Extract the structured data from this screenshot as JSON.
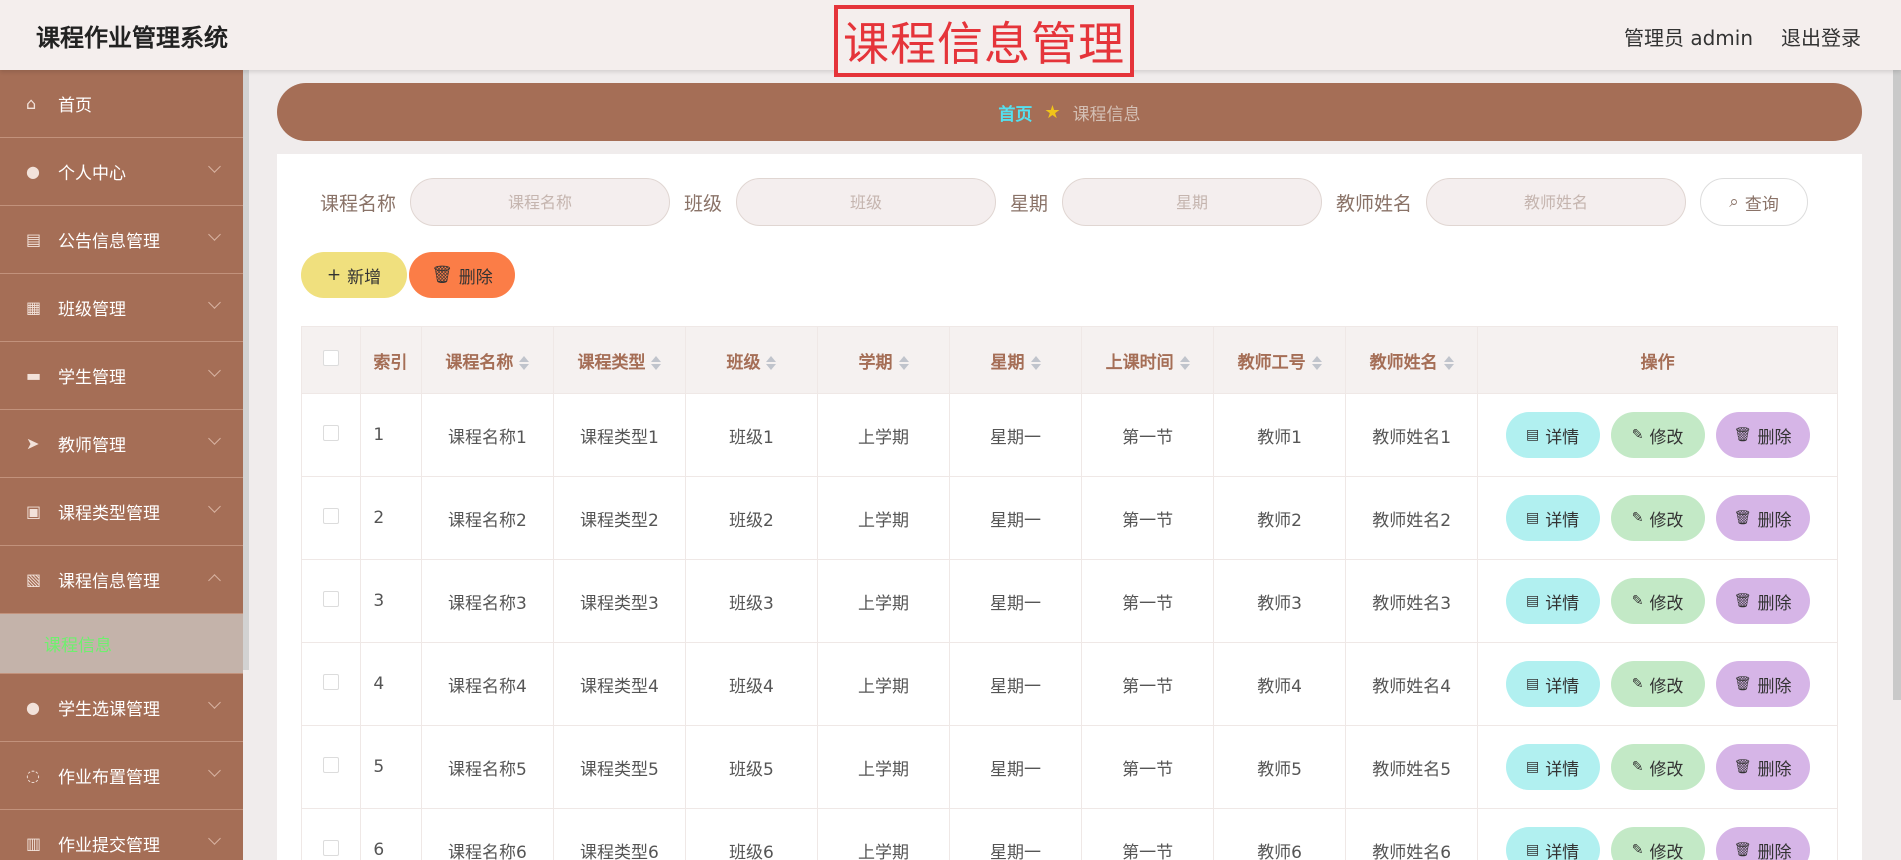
{
  "header": {
    "system_title": "课程作业管理系统",
    "page_title": "课程信息管理",
    "user_label": "管理员 admin",
    "logout_label": "退出登录"
  },
  "sidebar": {
    "items": [
      {
        "label": "首页",
        "icon": "home-icon",
        "glyph": "⌂",
        "has_arrow": false
      },
      {
        "label": "个人中心",
        "icon": "user-icon",
        "glyph": "●",
        "has_arrow": true
      },
      {
        "label": "公告信息管理",
        "icon": "clipboard-icon",
        "glyph": "▤",
        "has_arrow": true
      },
      {
        "label": "班级管理",
        "icon": "grid-icon",
        "glyph": "▦",
        "has_arrow": true
      },
      {
        "label": "学生管理",
        "icon": "briefcase-icon",
        "glyph": "▬",
        "has_arrow": true
      },
      {
        "label": "教师管理",
        "icon": "send-icon",
        "glyph": "➤",
        "has_arrow": true
      },
      {
        "label": "课程类型管理",
        "icon": "toolbox-icon",
        "glyph": "▣",
        "has_arrow": true
      },
      {
        "label": "课程信息管理",
        "icon": "document-icon",
        "glyph": "▧",
        "has_arrow": true,
        "expanded": true
      }
    ],
    "subitem": "课程信息",
    "items_after": [
      {
        "label": "学生选课管理",
        "icon": "user-icon",
        "glyph": "●"
      },
      {
        "label": "作业布置管理",
        "icon": "power-icon",
        "glyph": "◌"
      },
      {
        "label": "作业提交管理",
        "icon": "bookshelf-icon",
        "glyph": "▥"
      }
    ]
  },
  "breadcrumb": {
    "home": "首页",
    "current": "课程信息"
  },
  "search": {
    "course_name_label": "课程名称",
    "course_name_placeholder": "课程名称",
    "class_label": "班级",
    "class_placeholder": "班级",
    "weekday_label": "星期",
    "weekday_placeholder": "星期",
    "teacher_label": "教师姓名",
    "teacher_placeholder": "教师姓名",
    "query_label": "查询"
  },
  "actions": {
    "add_label": "新增",
    "delete_label": "删除"
  },
  "table": {
    "headers": {
      "index": "索引",
      "course_name": "课程名称",
      "course_type": "课程类型",
      "class": "班级",
      "term": "学期",
      "weekday": "星期",
      "time": "上课时间",
      "teacher_id": "教师工号",
      "teacher_name": "教师姓名",
      "ops": "操作"
    },
    "ops_labels": {
      "detail": "详情",
      "edit": "修改",
      "remove": "删除"
    },
    "rows": [
      {
        "index": "1",
        "course_name": "课程名称1",
        "course_type": "课程类型1",
        "class": "班级1",
        "term": "上学期",
        "weekday": "星期一",
        "time": "第一节",
        "teacher_id": "教师1",
        "teacher_name": "教师姓名1"
      },
      {
        "index": "2",
        "course_name": "课程名称2",
        "course_type": "课程类型2",
        "class": "班级2",
        "term": "上学期",
        "weekday": "星期一",
        "time": "第一节",
        "teacher_id": "教师2",
        "teacher_name": "教师姓名2"
      },
      {
        "index": "3",
        "course_name": "课程名称3",
        "course_type": "课程类型3",
        "class": "班级3",
        "term": "上学期",
        "weekday": "星期一",
        "time": "第一节",
        "teacher_id": "教师3",
        "teacher_name": "教师姓名3"
      },
      {
        "index": "4",
        "course_name": "课程名称4",
        "course_type": "课程类型4",
        "class": "班级4",
        "term": "上学期",
        "weekday": "星期一",
        "time": "第一节",
        "teacher_id": "教师4",
        "teacher_name": "教师姓名4"
      },
      {
        "index": "5",
        "course_name": "课程名称5",
        "course_type": "课程类型5",
        "class": "班级5",
        "term": "上学期",
        "weekday": "星期一",
        "time": "第一节",
        "teacher_id": "教师5",
        "teacher_name": "教师姓名5"
      },
      {
        "index": "6",
        "course_name": "课程名称6",
        "course_type": "课程类型6",
        "class": "班级6",
        "term": "上学期",
        "weekday": "星期一",
        "time": "第一节",
        "teacher_id": "教师6",
        "teacher_name": "教师姓名6"
      }
    ]
  },
  "colors": {
    "brand": "#a56e56",
    "title_red": "#e5343a",
    "breadcrumb_home": "#54e0f0",
    "active_submenu_text": "#6ef06e",
    "add_button": "#f0e07e",
    "delete_button": "#fb7d47",
    "detail_button": "#b1f0f0",
    "edit_button": "#c3e9c6",
    "remove_button": "#d6b5e7"
  }
}
